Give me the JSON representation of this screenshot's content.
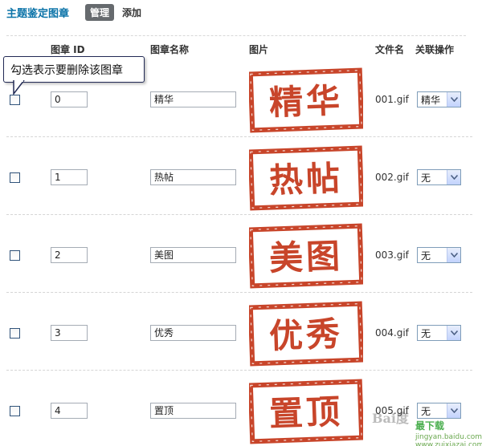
{
  "header": {
    "title": "主题鉴定图章",
    "tab_manage": "管理",
    "tab_add": "添加"
  },
  "columns": {
    "id": "图章 ID",
    "name": "图章名称",
    "image": "图片",
    "filename": "文件名",
    "relation": "关联操作"
  },
  "tooltip": "勾选表示要删除该图章",
  "rows": [
    {
      "id": "0",
      "name": "精华",
      "stamp": "精华",
      "filename": "001.gif",
      "relation": "精华"
    },
    {
      "id": "1",
      "name": "热帖",
      "stamp": "热帖",
      "filename": "002.gif",
      "relation": "无"
    },
    {
      "id": "2",
      "name": "美图",
      "stamp": "美图",
      "filename": "003.gif",
      "relation": "无"
    },
    {
      "id": "3",
      "name": "优秀",
      "stamp": "优秀",
      "filename": "004.gif",
      "relation": "无"
    },
    {
      "id": "4",
      "name": "置顶",
      "stamp": "置顶",
      "filename": "005.gif",
      "relation": "无"
    }
  ],
  "watermark": {
    "logo": "Bai度",
    "site": "最下载",
    "url": "jingyan.baidu.com  www.zuixiazai.com"
  },
  "colors": {
    "title": "#0b73a8",
    "stamp_red": "#c8452a",
    "tab_bg": "#666a6e"
  }
}
